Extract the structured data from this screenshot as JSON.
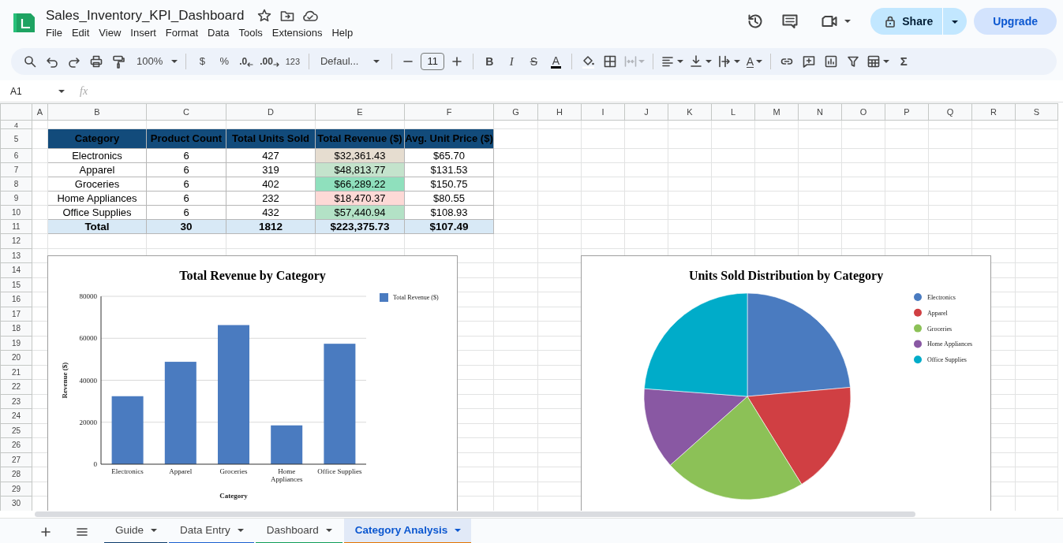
{
  "document": {
    "title": "Sales_Inventory_KPI_Dashboard",
    "menus": [
      "File",
      "Edit",
      "View",
      "Insert",
      "Format",
      "Data",
      "Tools",
      "Extensions",
      "Help"
    ]
  },
  "actions": {
    "share": "Share",
    "upgrade": "Upgrade"
  },
  "toolbar": {
    "zoom": "100%",
    "currency": "$",
    "percent": "%",
    "decrease_decimal": ".0",
    "increase_decimal": ".00",
    "more_formats": "123",
    "font": "Defaul...",
    "font_size": "11",
    "bold": "B",
    "italic": "I",
    "strikethrough": "S",
    "text_color": "A",
    "text_rotation": "A",
    "sum": "Σ",
    "merge": {
      "disabled": true
    }
  },
  "formula_bar": {
    "cell": "A1",
    "fx": "fx"
  },
  "columns": [
    "A",
    "B",
    "C",
    "D",
    "E",
    "F",
    "G",
    "H",
    "I",
    "J",
    "K",
    "L",
    "M",
    "N",
    "O",
    "P",
    "Q",
    "R",
    "S"
  ],
  "rows": [
    "4",
    "5",
    "6",
    "7",
    "8",
    "9",
    "10",
    "11",
    "12",
    "13",
    "14",
    "15",
    "16",
    "17",
    "18",
    "19",
    "20",
    "21",
    "22",
    "23",
    "24",
    "25",
    "26",
    "27",
    "28",
    "29",
    "30"
  ],
  "table": {
    "headers": [
      "Category",
      "Product Count",
      "Total Units Sold",
      "Total Revenue ($)",
      "Avg. Unit Price ($)"
    ],
    "rows": [
      {
        "cells": [
          "Electronics",
          "6",
          "427",
          "$32,361.43",
          "$65.70"
        ],
        "color": "#e6ddd0"
      },
      {
        "cells": [
          "Apparel",
          "6",
          "319",
          "$48,813.77",
          "$131.53"
        ],
        "color": "#c4e3cc"
      },
      {
        "cells": [
          "Groceries",
          "6",
          "402",
          "$66,289.22",
          "$150.75"
        ],
        "color": "#8fe0bd"
      },
      {
        "cells": [
          "Home Appliances",
          "6",
          "232",
          "$18,470.37",
          "$80.55"
        ],
        "color": "#fdd9d6"
      },
      {
        "cells": [
          "Office Supplies",
          "6",
          "432",
          "$57,440.94",
          "$108.93"
        ],
        "color": "#b3e2c6"
      }
    ],
    "total": [
      "Total",
      "30",
      "1812",
      "$223,375.73",
      "$107.49"
    ]
  },
  "charts": [
    {
      "chart_data": {
        "type": "bar",
        "title": "Total Revenue by Category",
        "xlabel": "Category",
        "ylabel": "Revenue ($)",
        "categories": [
          "Electronics",
          "Apparel",
          "Groceries",
          "Home Appliances",
          "Office Supplies"
        ],
        "series": [
          {
            "name": "Total Revenue ($)",
            "color": "#4a7bc0",
            "values": [
              32400,
              48800,
              66300,
              18500,
              57400
            ]
          }
        ],
        "ylim": [
          0,
          80000
        ],
        "yticks": [
          0,
          20000,
          40000,
          60000,
          80000
        ],
        "grid": true,
        "legend": true
      }
    },
    {
      "chart_data": {
        "type": "pie",
        "title": "Units Sold Distribution by Category",
        "categories": [
          "Electronics",
          "Apparel",
          "Groceries",
          "Home Appliances",
          "Office Supplies"
        ],
        "values": [
          23.6,
          17.6,
          22.2,
          12.8,
          23.8
        ],
        "legend": true,
        "colors": [
          "#4a7bc0",
          "#d03f43",
          "#8cc157",
          "#8958a3",
          "#00acc9"
        ]
      }
    }
  ],
  "sheet_tabs": [
    {
      "label": "Guide",
      "color": "#0b3a6b",
      "selected": false
    },
    {
      "label": "Data Entry",
      "color": "#1a5fd0",
      "selected": false
    },
    {
      "label": "Dashboard",
      "color": "#0f9d58",
      "selected": false
    },
    {
      "label": "Category Analysis",
      "color": "#e37400",
      "selected": true
    }
  ]
}
